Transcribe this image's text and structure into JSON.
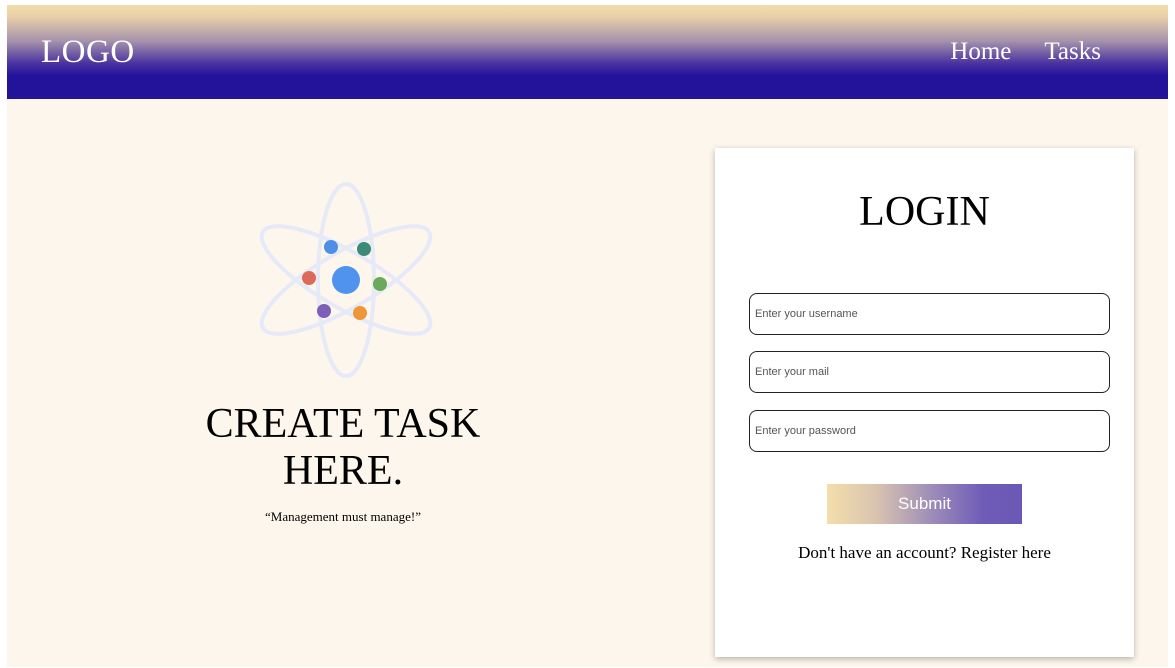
{
  "header": {
    "logo": "LOGO",
    "nav": [
      {
        "label": "Home"
      },
      {
        "label": "Tasks"
      }
    ]
  },
  "hero": {
    "title": "CREATE TASK HERE.",
    "quote": "“Management must manage!”",
    "illustration": {
      "icon": "atom-icon",
      "orbit_color": "#e6e9f7",
      "nucleus_color": "#4f93ee",
      "electron_colors": [
        "#4f8fe8",
        "#3e8a78",
        "#dc6a5a",
        "#6aaa5a",
        "#7d5fba",
        "#ee9638"
      ]
    }
  },
  "login": {
    "title": "LOGIN",
    "username_placeholder": "Enter your username",
    "email_placeholder": "Enter your mail",
    "password_placeholder": "Enter your password",
    "submit_label": "Submit",
    "register_prompt": "Don't have an account?",
    "register_link": "Register here"
  },
  "colors": {
    "page_background": "#fdf6ec",
    "nav_gradient_top": "#f4ddab",
    "nav_gradient_bottom": "#22139a",
    "button_gradient_start": "#f4deaa",
    "button_gradient_end": "#6b58b6"
  }
}
